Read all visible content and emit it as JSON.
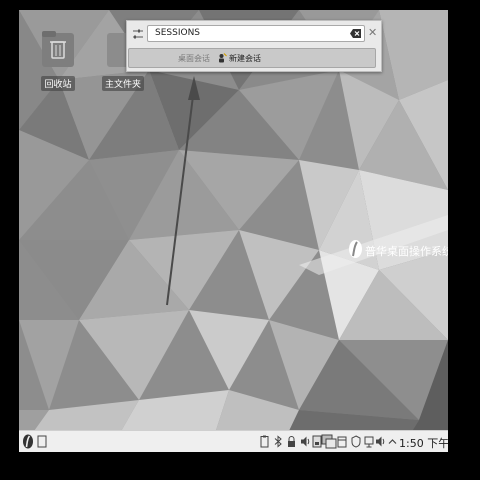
{
  "desktop": {
    "icons": [
      {
        "label": "回收站",
        "icon": "trash-icon"
      },
      {
        "label": "主文件夹",
        "icon": "folder-icon"
      }
    ],
    "brand_text": "普华桌面操作系统"
  },
  "krunner": {
    "query": "SESSIONS",
    "result_category": "桌面会话",
    "result_label": "新建会话"
  },
  "taskbar": {
    "clock": "1:50 下午"
  },
  "colors": {
    "taskbar_bg": "#efefef",
    "krunner_bg": "#e9e9e9",
    "result_bg": "#c9c9c9"
  }
}
